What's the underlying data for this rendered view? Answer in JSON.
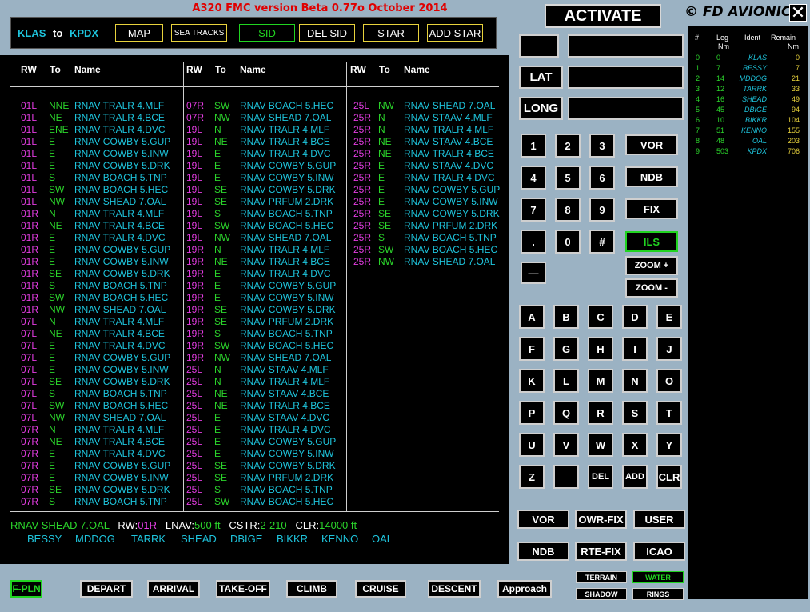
{
  "app": {
    "title": "A320 FMC version Beta 0.77o October 2014",
    "activate": "ACTIVATE",
    "brand": "© FD AVIONICS",
    "close": "✕"
  },
  "route": {
    "from": "KLAS",
    "to_word": "to",
    "to": "KPDX"
  },
  "top_buttons": [
    {
      "label": "MAP",
      "active": false
    },
    {
      "label": "SEA TRACKS",
      "active": false
    },
    {
      "label": "SID",
      "active": true
    },
    {
      "label": "DEL SID",
      "active": false
    },
    {
      "label": "STAR",
      "active": false
    },
    {
      "label": "ADD STAR",
      "active": false
    }
  ],
  "table_headers": {
    "rw": "RW",
    "to": "To",
    "name": "Name"
  },
  "columns": [
    [
      [
        "01L",
        "NNE",
        "RNAV TRALR 4.MLF"
      ],
      [
        "01L",
        "NE",
        "RNAV TRALR 4.BCE"
      ],
      [
        "01L",
        "ENE",
        "RNAV TRALR 4.DVC"
      ],
      [
        "01L",
        "E",
        "RNAV COWBY 5.GUP"
      ],
      [
        "01L",
        "E",
        "RNAV COWBY 5.INW"
      ],
      [
        "01L",
        "E",
        "RNAV COWBY 5.DRK"
      ],
      [
        "01L",
        "S",
        "RNAV BOACH 5.TNP"
      ],
      [
        "01L",
        "SW",
        "RNAV BOACH 5.HEC"
      ],
      [
        "01L",
        "NW",
        "RNAV SHEAD 7.OAL"
      ],
      [
        "01R",
        "N",
        "RNAV TRALR 4.MLF"
      ],
      [
        "01R",
        "NE",
        "RNAV TRALR 4.BCE"
      ],
      [
        "01R",
        "E",
        "RNAV TRALR 4.DVC"
      ],
      [
        "01R",
        "E",
        "RNAV COWBY 5.GUP"
      ],
      [
        "01R",
        "E",
        "RNAV COWBY 5.INW"
      ],
      [
        "01R",
        "SE",
        "RNAV COWBY 5.DRK"
      ],
      [
        "01R",
        "S",
        "RNAV BOACH 5.TNP"
      ],
      [
        "01R",
        "SW",
        "RNAV BOACH 5.HEC"
      ],
      [
        "01R",
        "NW",
        "RNAV SHEAD 7.OAL"
      ],
      [
        "07L",
        "N",
        "RNAV TRALR 4.MLF"
      ],
      [
        "07L",
        "NE",
        "RNAV TRALR 4.BCE"
      ],
      [
        "07L",
        "E",
        "RNAV TRALR 4.DVC"
      ],
      [
        "07L",
        "E",
        "RNAV COWBY 5.GUP"
      ],
      [
        "07L",
        "E",
        "RNAV COWBY 5.INW"
      ],
      [
        "07L",
        "SE",
        "RNAV COWBY 5.DRK"
      ],
      [
        "07L",
        "S",
        "RNAV BOACH 5.TNP"
      ],
      [
        "07L",
        "SW",
        "RNAV BOACH 5.HEC"
      ],
      [
        "07L",
        "NW",
        "RNAV SHEAD 7.OAL"
      ],
      [
        "07R",
        "N",
        "RNAV TRALR 4.MLF"
      ],
      [
        "07R",
        "NE",
        "RNAV TRALR 4.BCE"
      ],
      [
        "07R",
        "E",
        "RNAV TRALR 4.DVC"
      ],
      [
        "07R",
        "E",
        "RNAV COWBY 5.GUP"
      ],
      [
        "07R",
        "E",
        "RNAV COWBY 5.INW"
      ],
      [
        "07R",
        "SE",
        "RNAV COWBY 5.DRK"
      ],
      [
        "07R",
        "S",
        "RNAV BOACH 5.TNP"
      ]
    ],
    [
      [
        "07R",
        "SW",
        "RNAV BOACH 5.HEC"
      ],
      [
        "07R",
        "NW",
        "RNAV SHEAD 7.OAL"
      ],
      [
        "19L",
        "N",
        "RNAV TRALR 4.MLF"
      ],
      [
        "19L",
        "NE",
        "RNAV TRALR 4.BCE"
      ],
      [
        "19L",
        "E",
        "RNAV TRALR 4.DVC"
      ],
      [
        "19L",
        "E",
        "RNAV COWBY 5.GUP"
      ],
      [
        "19L",
        "E",
        "RNAV COWBY 5.INW"
      ],
      [
        "19L",
        "SE",
        "RNAV COWBY 5.DRK"
      ],
      [
        "19L",
        "SE",
        "RNAV PRFUM 2.DRK"
      ],
      [
        "19L",
        "S",
        "RNAV BOACH 5.TNP"
      ],
      [
        "19L",
        "SW",
        "RNAV BOACH 5.HEC"
      ],
      [
        "19L",
        "NW",
        "RNAV SHEAD 7.OAL"
      ],
      [
        "19R",
        "N",
        "RNAV TRALR 4.MLF"
      ],
      [
        "19R",
        "NE",
        "RNAV TRALR 4.BCE"
      ],
      [
        "19R",
        "E",
        "RNAV TRALR 4.DVC"
      ],
      [
        "19R",
        "E",
        "RNAV COWBY 5.GUP"
      ],
      [
        "19R",
        "E",
        "RNAV COWBY 5.INW"
      ],
      [
        "19R",
        "SE",
        "RNAV COWBY 5.DRK"
      ],
      [
        "19R",
        "SE",
        "RNAV PRFUM 2.DRK"
      ],
      [
        "19R",
        "S",
        "RNAV BOACH 5.TNP"
      ],
      [
        "19R",
        "SW",
        "RNAV BOACH 5.HEC"
      ],
      [
        "19R",
        "NW",
        "RNAV SHEAD 7.OAL"
      ],
      [
        "25L",
        "N",
        "RNAV STAAV 4.MLF"
      ],
      [
        "25L",
        "N",
        "RNAV TRALR 4.MLF"
      ],
      [
        "25L",
        "NE",
        "RNAV STAAV 4.BCE"
      ],
      [
        "25L",
        "NE",
        "RNAV TRALR 4.BCE"
      ],
      [
        "25L",
        "E",
        "RNAV STAAV 4.DVC"
      ],
      [
        "25L",
        "E",
        "RNAV TRALR 4.DVC"
      ],
      [
        "25L",
        "E",
        "RNAV COWBY 5.GUP"
      ],
      [
        "25L",
        "E",
        "RNAV COWBY 5.INW"
      ],
      [
        "25L",
        "SE",
        "RNAV COWBY 5.DRK"
      ],
      [
        "25L",
        "SE",
        "RNAV PRFUM 2.DRK"
      ],
      [
        "25L",
        "S",
        "RNAV BOACH 5.TNP"
      ],
      [
        "25L",
        "SW",
        "RNAV BOACH 5.HEC"
      ]
    ],
    [
      [
        "25L",
        "NW",
        "RNAV SHEAD 7.OAL"
      ],
      [
        "25R",
        "N",
        "RNAV STAAV 4.MLF"
      ],
      [
        "25R",
        "N",
        "RNAV TRALR 4.MLF"
      ],
      [
        "25R",
        "NE",
        "RNAV STAAV 4.BCE"
      ],
      [
        "25R",
        "NE",
        "RNAV TRALR 4.BCE"
      ],
      [
        "25R",
        "E",
        "RNAV STAAV 4.DVC"
      ],
      [
        "25R",
        "E",
        "RNAV TRALR 4.DVC"
      ],
      [
        "25R",
        "E",
        "RNAV COWBY 5.GUP"
      ],
      [
        "25R",
        "E",
        "RNAV COWBY 5.INW"
      ],
      [
        "25R",
        "SE",
        "RNAV COWBY 5.DRK"
      ],
      [
        "25R",
        "SE",
        "RNAV PRFUM 2.DRK"
      ],
      [
        "25R",
        "S",
        "RNAV BOACH 5.TNP"
      ],
      [
        "25R",
        "SW",
        "RNAV BOACH 5.HEC"
      ],
      [
        "25R",
        "NW",
        "RNAV SHEAD 7.OAL"
      ]
    ]
  ],
  "status": {
    "sid": "RNAV SHEAD 7.OAL",
    "rw_label": "RW:",
    "rw": "01R",
    "lnav_label": "LNAV:",
    "lnav": "500 ft",
    "cstr_label": "CSTR:",
    "cstr": "2-210",
    "clr_label": "CLR:",
    "clr": "14000 ft",
    "waypoints": [
      "BESSY",
      "MDDOG",
      "TARRK",
      "SHEAD",
      "DBIGE",
      "BIKKR",
      "KENNO",
      "OAL"
    ]
  },
  "entry": {
    "lat": "LAT",
    "long": "LONG"
  },
  "keypad": {
    "digits": [
      "1",
      "2",
      "3",
      "4",
      "5",
      "6",
      "7",
      "8",
      "9",
      ".",
      "0",
      "#"
    ],
    "minus": "—",
    "nav": [
      "VOR",
      "NDB",
      "FIX",
      "ILS"
    ],
    "zoom_in": "ZOOM +",
    "zoom_out": "ZOOM -",
    "letters": [
      "A",
      "B",
      "C",
      "D",
      "E",
      "F",
      "G",
      "H",
      "I",
      "J",
      "K",
      "L",
      "M",
      "N",
      "O",
      "P",
      "Q",
      "R",
      "S",
      "T",
      "U",
      "V",
      "W",
      "X",
      "Y",
      "Z",
      "__",
      "DEL",
      "ADD",
      "CLR"
    ]
  },
  "db_buttons": [
    "VOR",
    "OWR-FIX",
    "USER",
    "NDB",
    "RTE-FIX",
    "ICAO"
  ],
  "map_toggles": [
    {
      "label": "TERRAIN",
      "active": false
    },
    {
      "label": "WATER",
      "active": true
    },
    {
      "label": "SHADOW",
      "active": false
    },
    {
      "label": "RINGS",
      "active": false
    }
  ],
  "bottom_tabs": [
    {
      "label": "F-PLN",
      "active": true
    },
    {
      "label": "DEPART",
      "active": false
    },
    {
      "label": "ARRIVAL",
      "active": false
    },
    {
      "label": "TAKE-OFF",
      "active": false
    },
    {
      "label": "CLIMB",
      "active": false
    },
    {
      "label": "CRUISE",
      "active": false
    },
    {
      "label": "DESCENT",
      "active": false
    },
    {
      "label": "Approach",
      "active": false
    }
  ],
  "legs": {
    "headers": {
      "num": "#",
      "leg": "Leg",
      "leg_unit": "Nm",
      "ident": "Ident",
      "remain": "Remain",
      "remain_unit": "Nm"
    },
    "rows": [
      [
        "0",
        "0",
        "KLAS",
        "0"
      ],
      [
        "1",
        "7",
        "BESSY",
        "7"
      ],
      [
        "2",
        "14",
        "MDDOG",
        "21"
      ],
      [
        "3",
        "12",
        "TARRK",
        "33"
      ],
      [
        "4",
        "16",
        "SHEAD",
        "49"
      ],
      [
        "5",
        "45",
        "DBIGE",
        "94"
      ],
      [
        "6",
        "10",
        "BIKKR",
        "104"
      ],
      [
        "7",
        "51",
        "KENNO",
        "155"
      ],
      [
        "8",
        "48",
        "OAL",
        "203"
      ],
      [
        "9",
        "503",
        "KPDX",
        "706"
      ]
    ]
  }
}
